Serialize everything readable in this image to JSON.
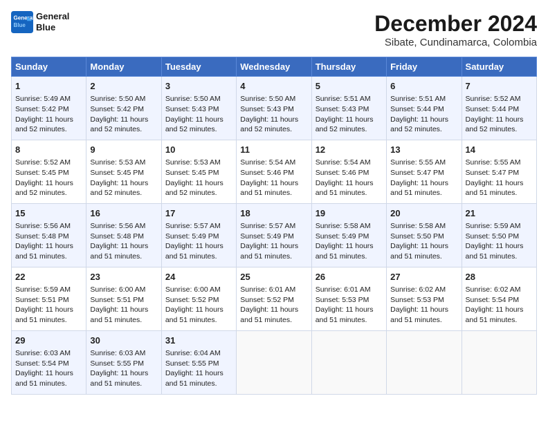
{
  "logo": {
    "line1": "General",
    "line2": "Blue"
  },
  "title": "December 2024",
  "subtitle": "Sibate, Cundinamarca, Colombia",
  "days_of_week": [
    "Sunday",
    "Monday",
    "Tuesday",
    "Wednesday",
    "Thursday",
    "Friday",
    "Saturday"
  ],
  "weeks": [
    [
      {
        "day": "1",
        "sunrise": "Sunrise: 5:49 AM",
        "sunset": "Sunset: 5:42 PM",
        "daylight": "Daylight: 11 hours and 52 minutes."
      },
      {
        "day": "2",
        "sunrise": "Sunrise: 5:50 AM",
        "sunset": "Sunset: 5:42 PM",
        "daylight": "Daylight: 11 hours and 52 minutes."
      },
      {
        "day": "3",
        "sunrise": "Sunrise: 5:50 AM",
        "sunset": "Sunset: 5:43 PM",
        "daylight": "Daylight: 11 hours and 52 minutes."
      },
      {
        "day": "4",
        "sunrise": "Sunrise: 5:50 AM",
        "sunset": "Sunset: 5:43 PM",
        "daylight": "Daylight: 11 hours and 52 minutes."
      },
      {
        "day": "5",
        "sunrise": "Sunrise: 5:51 AM",
        "sunset": "Sunset: 5:43 PM",
        "daylight": "Daylight: 11 hours and 52 minutes."
      },
      {
        "day": "6",
        "sunrise": "Sunrise: 5:51 AM",
        "sunset": "Sunset: 5:44 PM",
        "daylight": "Daylight: 11 hours and 52 minutes."
      },
      {
        "day": "7",
        "sunrise": "Sunrise: 5:52 AM",
        "sunset": "Sunset: 5:44 PM",
        "daylight": "Daylight: 11 hours and 52 minutes."
      }
    ],
    [
      {
        "day": "8",
        "sunrise": "Sunrise: 5:52 AM",
        "sunset": "Sunset: 5:45 PM",
        "daylight": "Daylight: 11 hours and 52 minutes."
      },
      {
        "day": "9",
        "sunrise": "Sunrise: 5:53 AM",
        "sunset": "Sunset: 5:45 PM",
        "daylight": "Daylight: 11 hours and 52 minutes."
      },
      {
        "day": "10",
        "sunrise": "Sunrise: 5:53 AM",
        "sunset": "Sunset: 5:45 PM",
        "daylight": "Daylight: 11 hours and 52 minutes."
      },
      {
        "day": "11",
        "sunrise": "Sunrise: 5:54 AM",
        "sunset": "Sunset: 5:46 PM",
        "daylight": "Daylight: 11 hours and 51 minutes."
      },
      {
        "day": "12",
        "sunrise": "Sunrise: 5:54 AM",
        "sunset": "Sunset: 5:46 PM",
        "daylight": "Daylight: 11 hours and 51 minutes."
      },
      {
        "day": "13",
        "sunrise": "Sunrise: 5:55 AM",
        "sunset": "Sunset: 5:47 PM",
        "daylight": "Daylight: 11 hours and 51 minutes."
      },
      {
        "day": "14",
        "sunrise": "Sunrise: 5:55 AM",
        "sunset": "Sunset: 5:47 PM",
        "daylight": "Daylight: 11 hours and 51 minutes."
      }
    ],
    [
      {
        "day": "15",
        "sunrise": "Sunrise: 5:56 AM",
        "sunset": "Sunset: 5:48 PM",
        "daylight": "Daylight: 11 hours and 51 minutes."
      },
      {
        "day": "16",
        "sunrise": "Sunrise: 5:56 AM",
        "sunset": "Sunset: 5:48 PM",
        "daylight": "Daylight: 11 hours and 51 minutes."
      },
      {
        "day": "17",
        "sunrise": "Sunrise: 5:57 AM",
        "sunset": "Sunset: 5:49 PM",
        "daylight": "Daylight: 11 hours and 51 minutes."
      },
      {
        "day": "18",
        "sunrise": "Sunrise: 5:57 AM",
        "sunset": "Sunset: 5:49 PM",
        "daylight": "Daylight: 11 hours and 51 minutes."
      },
      {
        "day": "19",
        "sunrise": "Sunrise: 5:58 AM",
        "sunset": "Sunset: 5:49 PM",
        "daylight": "Daylight: 11 hours and 51 minutes."
      },
      {
        "day": "20",
        "sunrise": "Sunrise: 5:58 AM",
        "sunset": "Sunset: 5:50 PM",
        "daylight": "Daylight: 11 hours and 51 minutes."
      },
      {
        "day": "21",
        "sunrise": "Sunrise: 5:59 AM",
        "sunset": "Sunset: 5:50 PM",
        "daylight": "Daylight: 11 hours and 51 minutes."
      }
    ],
    [
      {
        "day": "22",
        "sunrise": "Sunrise: 5:59 AM",
        "sunset": "Sunset: 5:51 PM",
        "daylight": "Daylight: 11 hours and 51 minutes."
      },
      {
        "day": "23",
        "sunrise": "Sunrise: 6:00 AM",
        "sunset": "Sunset: 5:51 PM",
        "daylight": "Daylight: 11 hours and 51 minutes."
      },
      {
        "day": "24",
        "sunrise": "Sunrise: 6:00 AM",
        "sunset": "Sunset: 5:52 PM",
        "daylight": "Daylight: 11 hours and 51 minutes."
      },
      {
        "day": "25",
        "sunrise": "Sunrise: 6:01 AM",
        "sunset": "Sunset: 5:52 PM",
        "daylight": "Daylight: 11 hours and 51 minutes."
      },
      {
        "day": "26",
        "sunrise": "Sunrise: 6:01 AM",
        "sunset": "Sunset: 5:53 PM",
        "daylight": "Daylight: 11 hours and 51 minutes."
      },
      {
        "day": "27",
        "sunrise": "Sunrise: 6:02 AM",
        "sunset": "Sunset: 5:53 PM",
        "daylight": "Daylight: 11 hours and 51 minutes."
      },
      {
        "day": "28",
        "sunrise": "Sunrise: 6:02 AM",
        "sunset": "Sunset: 5:54 PM",
        "daylight": "Daylight: 11 hours and 51 minutes."
      }
    ],
    [
      {
        "day": "29",
        "sunrise": "Sunrise: 6:03 AM",
        "sunset": "Sunset: 5:54 PM",
        "daylight": "Daylight: 11 hours and 51 minutes."
      },
      {
        "day": "30",
        "sunrise": "Sunrise: 6:03 AM",
        "sunset": "Sunset: 5:55 PM",
        "daylight": "Daylight: 11 hours and 51 minutes."
      },
      {
        "day": "31",
        "sunrise": "Sunrise: 6:04 AM",
        "sunset": "Sunset: 5:55 PM",
        "daylight": "Daylight: 11 hours and 51 minutes."
      },
      null,
      null,
      null,
      null
    ]
  ]
}
